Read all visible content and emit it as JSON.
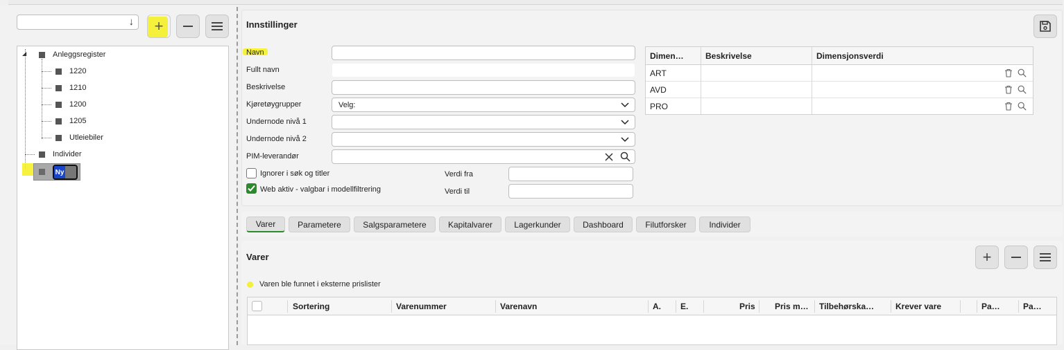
{
  "colors": {
    "accent_green": "#2b8a2b",
    "highlight_yellow": "#f6f01c",
    "selection_blue": "#1946c8"
  },
  "tree_panel": {
    "select_value": "",
    "tree": [
      {
        "label": "Anleggsregister"
      },
      {
        "label": "1220"
      },
      {
        "label": "1210"
      },
      {
        "label": "1200"
      },
      {
        "label": "1205"
      },
      {
        "label": "Utleiebiler"
      },
      {
        "label": "Individer"
      }
    ],
    "new_node_text": "Ny"
  },
  "settings": {
    "title": "Innstillinger",
    "fields": {
      "navn": {
        "label": "Navn",
        "value": ""
      },
      "fullt_navn": {
        "label": "Fullt navn",
        "value": ""
      },
      "beskrivelse": {
        "label": "Beskrivelse",
        "value": ""
      },
      "kjoretoygrupper": {
        "label": "Kjøretøygrupper",
        "value": "Velg:"
      },
      "undernode1": {
        "label": "Undernode nivå 1",
        "value": ""
      },
      "undernode2": {
        "label": "Undernode nivå 2",
        "value": ""
      },
      "pim": {
        "label": "PIM-leverandør",
        "value": ""
      },
      "ignorer": {
        "label": "Ignorer i søk og titler",
        "checked": false
      },
      "web_aktiv": {
        "label": "Web aktiv - valgbar i modellfiltrering",
        "checked": true
      },
      "verdi_fra": {
        "label": "Verdi fra",
        "value": ""
      },
      "verdi_til": {
        "label": "Verdi til",
        "value": ""
      }
    },
    "dimension_table": {
      "headers": [
        "Dimen…",
        "Beskrivelse",
        "Dimensjonsverdi"
      ],
      "rows": [
        {
          "dimension": "ART",
          "beskrivelse": "",
          "verdi": ""
        },
        {
          "dimension": "AVD",
          "beskrivelse": "",
          "verdi": ""
        },
        {
          "dimension": "PRO",
          "beskrivelse": "",
          "verdi": ""
        }
      ]
    }
  },
  "tabs": [
    {
      "label": "Varer",
      "active": true
    },
    {
      "label": "Parametere",
      "active": false
    },
    {
      "label": "Salgsparametere",
      "active": false
    },
    {
      "label": "Kapitalvarer",
      "active": false
    },
    {
      "label": "Lagerkunder",
      "active": false
    },
    {
      "label": "Dashboard",
      "active": false
    },
    {
      "label": "Filutforsker",
      "active": false
    },
    {
      "label": "Individer",
      "active": false
    }
  ],
  "varer": {
    "title": "Varer",
    "legend": "Varen ble funnet i eksterne prislister",
    "columns": [
      "Sortering",
      "Varenummer",
      "Varenavn",
      "A.",
      "E.",
      "Pris",
      "Pris m…",
      "Tilbehørska…",
      "Krever vare",
      "",
      "Pa…",
      "Pa…"
    ]
  }
}
